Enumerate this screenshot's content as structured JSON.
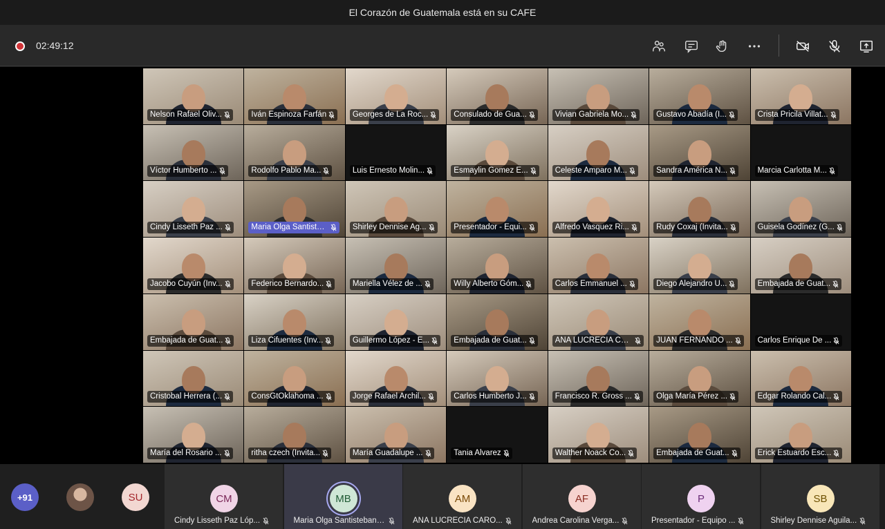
{
  "window": {
    "title": "El Corazón de Guatemala está en su CAFE"
  },
  "call": {
    "duration": "02:49:12",
    "recording": true
  },
  "toolbar": {
    "buttons": [
      {
        "name": "participants-icon"
      },
      {
        "name": "chat-icon"
      },
      {
        "name": "reactions-icon"
      },
      {
        "name": "more-actions-icon"
      },
      {
        "name": "camera-off-icon"
      },
      {
        "name": "mic-off-icon"
      },
      {
        "name": "share-screen-icon"
      }
    ]
  },
  "video_grid": {
    "tiles": [
      "Nelson Rafael Oliv...",
      "Iván Espinoza Farfán",
      "Georges de La Roc...",
      "Consulado de Gua...",
      "Vivian Gabriela Mo...",
      "Gustavo Abadía (I...",
      "Crista Pricila Villat...",
      "Víctor Humberto ...",
      "Rodolfo Pablo Ma...",
      "Luis Ernesto Molin...",
      "Esmaylin Gomez E...",
      "Celeste Amparo M...",
      "Sandra América N...",
      "Marcia Carlotta M...",
      "Cindy Lisseth Paz ...",
      "Maria Olga Santisteb...",
      "Shirley Dennise Ag...",
      "Presentador - Equi...",
      "Alfredo Vasquez Ri...",
      "Rudy Coxaj (Invita...",
      "Guisela Godínez (G...",
      "Jacobo Cuyún (Inv...",
      "Federico Bernardo...",
      "Mariella Vélez de ...",
      "Willy Alberto Góm...",
      "Carlos Emmanuel ...",
      "Diego Alejandro U...",
      "Embajada de Guat...",
      "Embajada de Guat...",
      "Liza Cifuentes (Inv...",
      "Guillermo López - E...",
      "Embajada de Guat...",
      "ANA LUCRECIA CA...",
      "JUAN FERNANDO ...",
      "Carlos Enrique De ...",
      "Cristobal Herrera (...",
      "ConsGtOklahoma ...",
      "Jorge Rafael Archil...",
      "Carlos Humberto J...",
      "Francisco R. Gross ...",
      "Olga María Pérez ...",
      "Edgar Rolando Cal...",
      "María del Rosario ...",
      "ritha czech (Invita...",
      "María Guadalupe ...",
      "Tania Alvarez",
      "Walther Noack Co...",
      "Embajada de Guat...",
      "Erick Estuardo Esc..."
    ],
    "highlighted_index": 15
  },
  "bottom_bar": {
    "overflow_count": "+91",
    "small_avatar_initials": "SU",
    "participants": [
      {
        "initials": "CM",
        "name": "Cindy Lisseth Paz Lóp...",
        "bg": "#f0d4e6",
        "fg": "#7a2757"
      },
      {
        "initials": "MB",
        "name": "Maria Olga Santisteban Bl...",
        "bg": "#cfe7d6",
        "fg": "#205b35",
        "active": true
      },
      {
        "initials": "AM",
        "name": "ANA LUCRECIA CARO...",
        "bg": "#f9e3c3",
        "fg": "#7a4a07"
      },
      {
        "initials": "AF",
        "name": "Andrea Carolina Verga...",
        "bg": "#f6d3cf",
        "fg": "#8a2c22"
      },
      {
        "initials": "P",
        "name": "Presentador - Equipo ...",
        "bg": "#efd2f0",
        "fg": "#6b2c78"
      },
      {
        "initials": "SB",
        "name": "Shirley Dennise Aguila...",
        "bg": "#f8e6b8",
        "fg": "#6d5000"
      }
    ]
  },
  "colors": {
    "accent": "#5b5fc7",
    "record": "#d13438"
  }
}
